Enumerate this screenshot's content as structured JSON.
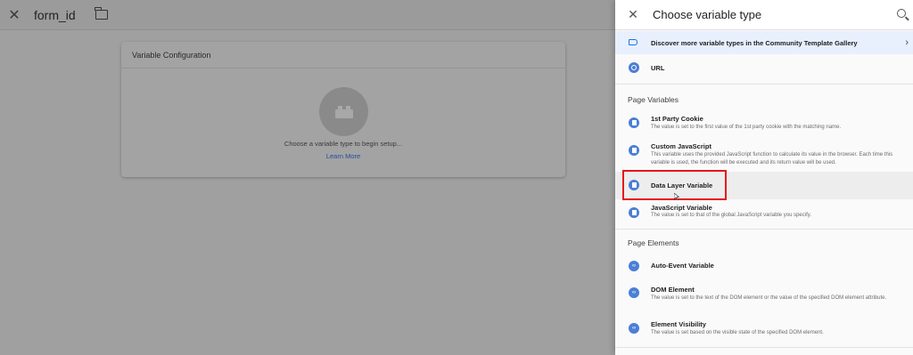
{
  "editor": {
    "title": "form_id",
    "card_title": "Variable Configuration",
    "hint": "Choose a variable type to begin setup...",
    "learn_more": "Learn More"
  },
  "panel": {
    "title": "Choose variable type",
    "banner": "Discover more variable types in the Community Template Gallery",
    "url_item": "URL",
    "section_page_variables": "Page Variables",
    "section_page_elements": "Page Elements",
    "items": [
      {
        "name": "1st Party Cookie",
        "desc": "The value is set to the first value of the 1st party cookie with the matching name."
      },
      {
        "name": "Custom JavaScript",
        "desc": "This variable uses the provided JavaScript function to calculate its value in the browser. Each time this variable is used, the function will be executed and its return value will be used."
      },
      {
        "name": "Data Layer Variable",
        "desc": ""
      },
      {
        "name": "JavaScript Variable",
        "desc": "The value is set to that of the global JavaScript variable you specify."
      },
      {
        "name": "Auto-Event Variable",
        "desc": ""
      },
      {
        "name": "DOM Element",
        "desc": "The value is set to the text of the DOM element or the value of the specified DOM element attribute."
      },
      {
        "name": "Element Visibility",
        "desc": "The value is set based on the visible state of the specified DOM element."
      }
    ]
  },
  "colors": {
    "accent": "#1a73e8",
    "highlight_border": "#e8141b",
    "banner_bg": "#e8f0fe"
  }
}
